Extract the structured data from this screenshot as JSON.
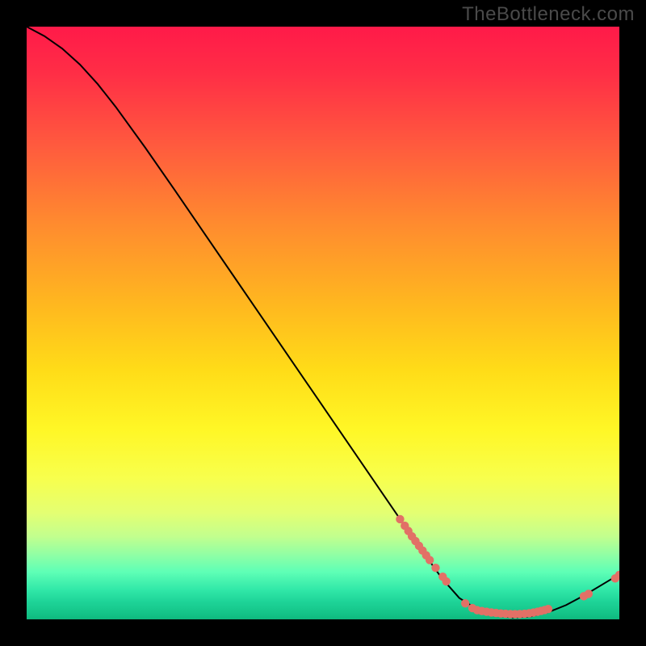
{
  "watermark": "TheBottleneck.com",
  "chart_data": {
    "type": "line",
    "title": "",
    "xlabel": "",
    "ylabel": "",
    "xlim": [
      0,
      100
    ],
    "ylim": [
      0,
      100
    ],
    "curve": [
      {
        "x": 0.0,
        "y": 100.0
      },
      {
        "x": 3.0,
        "y": 98.4
      },
      {
        "x": 6.0,
        "y": 96.3
      },
      {
        "x": 9.0,
        "y": 93.6
      },
      {
        "x": 12.0,
        "y": 90.3
      },
      {
        "x": 15.0,
        "y": 86.5
      },
      {
        "x": 20.0,
        "y": 79.6
      },
      {
        "x": 25.0,
        "y": 72.4
      },
      {
        "x": 30.0,
        "y": 65.1
      },
      {
        "x": 35.0,
        "y": 57.8
      },
      {
        "x": 40.0,
        "y": 50.5
      },
      {
        "x": 45.0,
        "y": 43.2
      },
      {
        "x": 50.0,
        "y": 35.9
      },
      {
        "x": 55.0,
        "y": 28.6
      },
      {
        "x": 60.0,
        "y": 21.3
      },
      {
        "x": 65.0,
        "y": 14.0
      },
      {
        "x": 70.0,
        "y": 7.0
      },
      {
        "x": 73.0,
        "y": 3.6
      },
      {
        "x": 76.0,
        "y": 1.7
      },
      {
        "x": 79.0,
        "y": 0.7
      },
      {
        "x": 82.0,
        "y": 0.3
      },
      {
        "x": 85.0,
        "y": 0.5
      },
      {
        "x": 88.0,
        "y": 1.2
      },
      {
        "x": 91.0,
        "y": 2.4
      },
      {
        "x": 94.0,
        "y": 4.0
      },
      {
        "x": 97.0,
        "y": 5.8
      },
      {
        "x": 100.0,
        "y": 7.6
      }
    ],
    "markers": [
      {
        "x": 63.0,
        "y": 16.9
      },
      {
        "x": 63.8,
        "y": 15.8
      },
      {
        "x": 64.4,
        "y": 14.9
      },
      {
        "x": 65.0,
        "y": 14.0
      },
      {
        "x": 65.6,
        "y": 13.2
      },
      {
        "x": 66.2,
        "y": 12.4
      },
      {
        "x": 66.8,
        "y": 11.6
      },
      {
        "x": 67.4,
        "y": 10.8
      },
      {
        "x": 68.0,
        "y": 10.0
      },
      {
        "x": 69.0,
        "y": 8.7
      },
      {
        "x": 70.2,
        "y": 7.2
      },
      {
        "x": 70.8,
        "y": 6.4
      },
      {
        "x": 74.0,
        "y": 2.7
      },
      {
        "x": 75.2,
        "y": 1.9
      },
      {
        "x": 76.0,
        "y": 1.55
      },
      {
        "x": 76.8,
        "y": 1.4
      },
      {
        "x": 77.6,
        "y": 1.28
      },
      {
        "x": 78.4,
        "y": 1.17
      },
      {
        "x": 79.2,
        "y": 1.08
      },
      {
        "x": 80.0,
        "y": 1.0
      },
      {
        "x": 80.8,
        "y": 0.94
      },
      {
        "x": 81.6,
        "y": 0.9
      },
      {
        "x": 82.4,
        "y": 0.88
      },
      {
        "x": 83.2,
        "y": 0.9
      },
      {
        "x": 84.0,
        "y": 0.95
      },
      {
        "x": 84.8,
        "y": 1.03
      },
      {
        "x": 85.5,
        "y": 1.14
      },
      {
        "x": 86.2,
        "y": 1.28
      },
      {
        "x": 86.8,
        "y": 1.42
      },
      {
        "x": 87.4,
        "y": 1.58
      },
      {
        "x": 88.0,
        "y": 1.75
      },
      {
        "x": 94.0,
        "y": 3.9
      },
      {
        "x": 94.8,
        "y": 4.3
      },
      {
        "x": 99.3,
        "y": 6.9
      },
      {
        "x": 100.0,
        "y": 7.5
      }
    ],
    "marker_color": "#e27066",
    "line_color": "#000000"
  }
}
